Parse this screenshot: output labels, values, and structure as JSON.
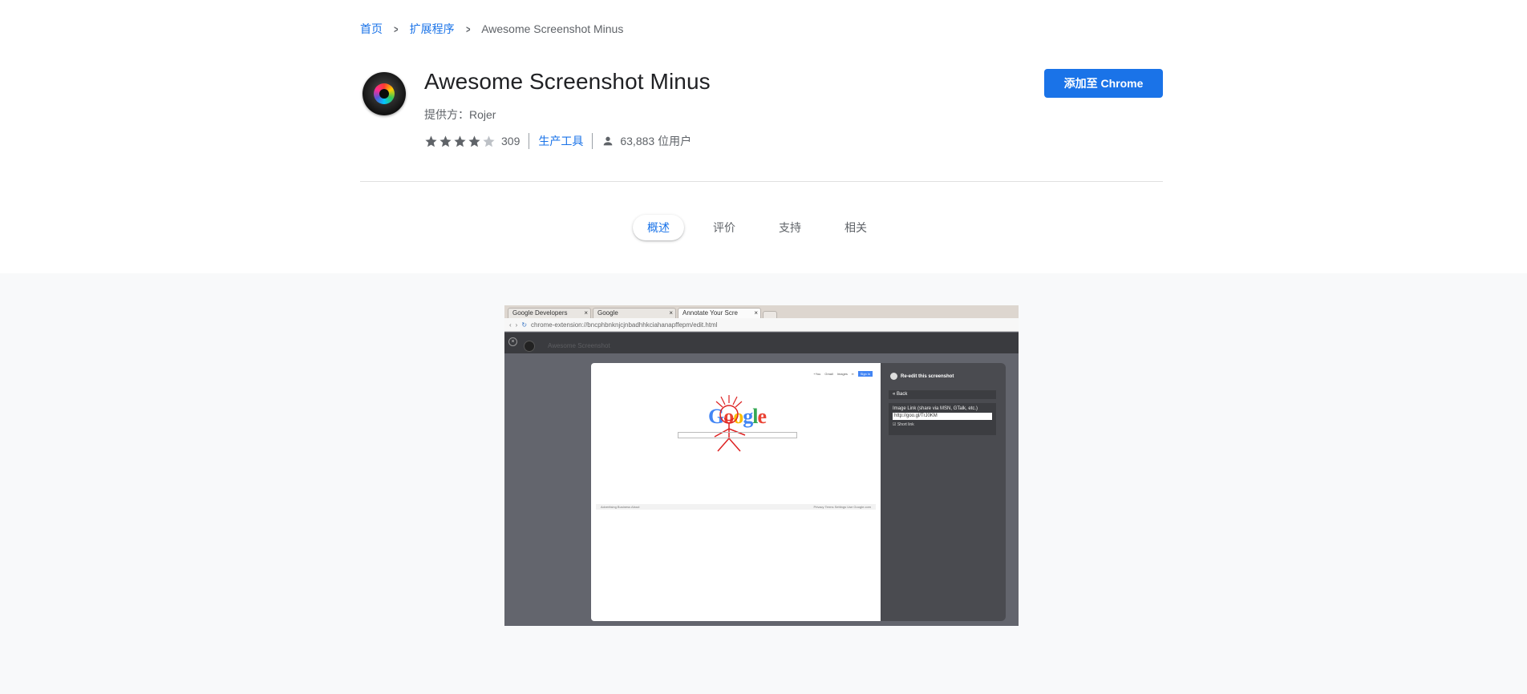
{
  "breadcrumb": {
    "home": "首页",
    "extensions": "扩展程序",
    "current": "Awesome Screenshot Minus"
  },
  "extension": {
    "name": "Awesome Screenshot Minus",
    "provider": "提供方：Rojer",
    "rating": 4,
    "rating_max": 5,
    "rating_count": "309",
    "category": "生产工具",
    "users": "63,883 位用户",
    "add_button": "添加至 Chrome"
  },
  "tabs": [
    {
      "label": "概述",
      "active": true
    },
    {
      "label": "评价",
      "active": false
    },
    {
      "label": "支持",
      "active": false
    },
    {
      "label": "相关",
      "active": false
    }
  ],
  "colors": {
    "accent": "#1a73e8",
    "star_filled": "#5f6368",
    "star_empty": "#bdc1c6"
  },
  "screenshot": {
    "browser_tabs": [
      {
        "label": "Google Developers",
        "selected": false
      },
      {
        "label": "Google",
        "selected": false
      },
      {
        "label": "Annotate Your Scre",
        "selected": true
      }
    ],
    "url": "chrome-extension://bncphbnknjcjnbadhhkciahanapffepm/edit.html",
    "app_title": "Awesome Screenshot",
    "panel_title": "Re-edit this screenshot",
    "back_label": "« Back",
    "image_link_label": "Image Link (share via MSN, GTalk, etc.)",
    "image_link_value": "http://goo.gl/TrJ0KM",
    "short_link_label": "Short link",
    "google_links": [
      "+You",
      "Gmail",
      "Images"
    ],
    "sign_in": "Sign in",
    "google_logo": "Google",
    "footer_left": [
      "Advertising",
      "Business",
      "About"
    ],
    "footer_right": [
      "Privacy",
      "Terms",
      "Settings",
      "Use Google.com"
    ]
  }
}
